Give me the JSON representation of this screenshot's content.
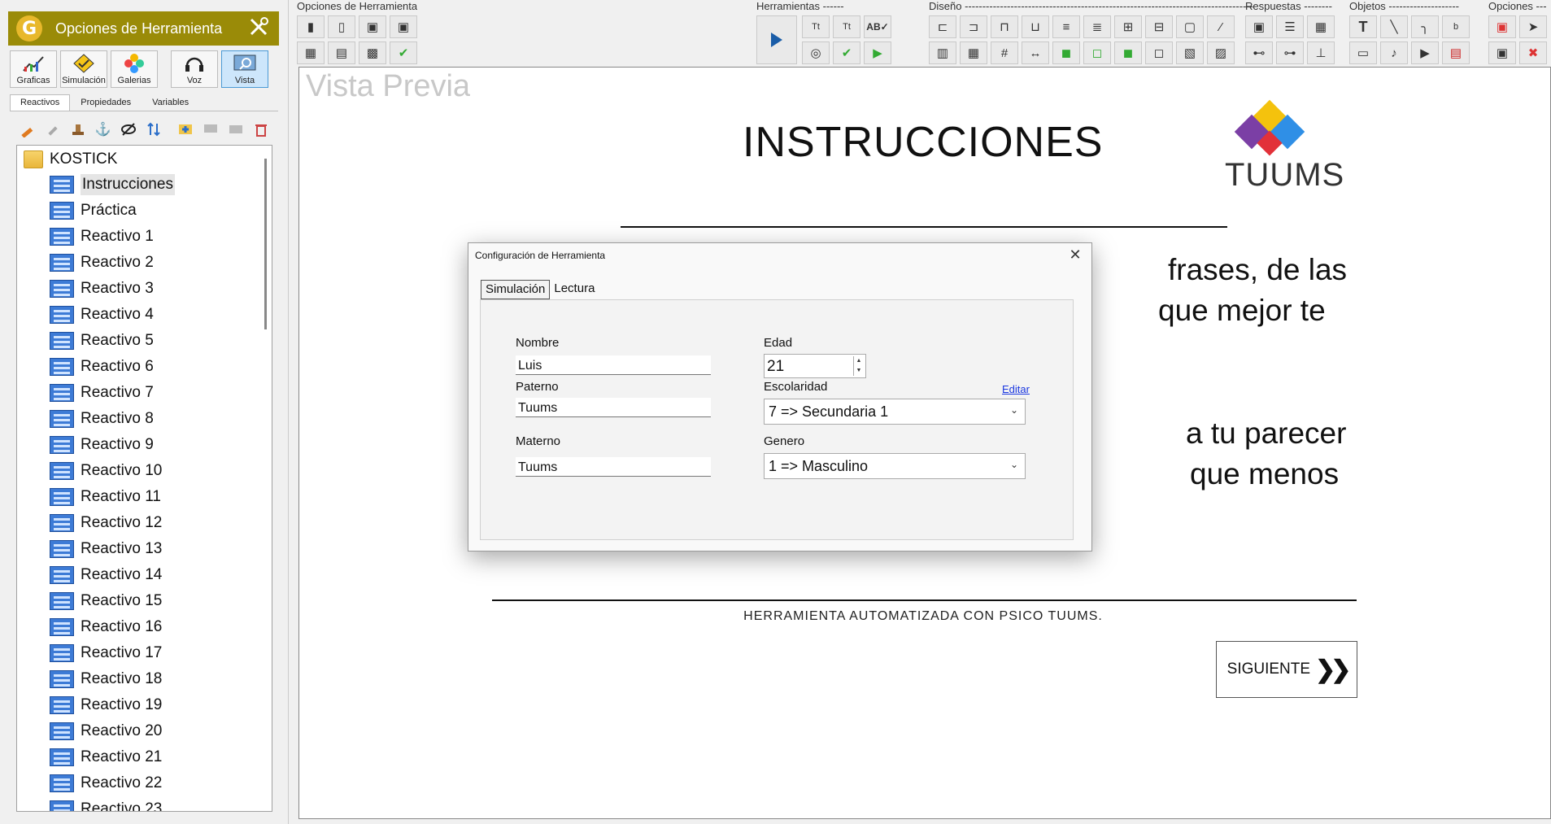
{
  "app": {
    "title": "Opciones de Herramienta",
    "brand_color": "#9a8b08"
  },
  "mode_buttons": [
    {
      "label": "Graficas",
      "icon": "chart-icon",
      "selected": false
    },
    {
      "label": "Simulación",
      "icon": "simulation-icon",
      "selected": false
    },
    {
      "label": "Galerias",
      "icon": "gallery-icon",
      "selected": false
    },
    {
      "label": "Voz",
      "icon": "headset-icon",
      "selected": false
    },
    {
      "label": "Vista",
      "icon": "preview-icon",
      "selected": true
    }
  ],
  "left_tabs": [
    "Reactivos",
    "Propiedades",
    "Variables"
  ],
  "tree": {
    "root": "KOSTICK",
    "items": [
      "Instrucciones",
      "Práctica",
      "Reactivo 1",
      "Reactivo 2",
      "Reactivo 3",
      "Reactivo 4",
      "Reactivo 5",
      "Reactivo 6",
      "Reactivo 7",
      "Reactivo 8",
      "Reactivo 9",
      "Reactivo 10",
      "Reactivo 11",
      "Reactivo 12",
      "Reactivo 13",
      "Reactivo 14",
      "Reactivo 15",
      "Reactivo 16",
      "Reactivo 17",
      "Reactivo 18",
      "Reactivo 19",
      "Reactivo 20",
      "Reactivo 21",
      "Reactivo 22",
      "Reactivo 23"
    ],
    "selected": "Instrucciones"
  },
  "toolbar": {
    "sections": {
      "opciones": "Opciones de Herramienta",
      "herramientas": "Herramientas ------",
      "diseno": "Diseño -----------------------------------------------------------------------------------",
      "respuestas": "Respuestas --------",
      "objetos": "Objetos --------------------",
      "opciones2": "Opciones ---"
    }
  },
  "preview": {
    "label": "Vista Previa",
    "heading": "INSTRUCCIONES",
    "logo_text": "TUUMS",
    "logo_colors": [
      "#7b3fa5",
      "#f4c20d",
      "#2f8fe6",
      "#e23139"
    ],
    "text_lines": [
      "frases, de las",
      "que   mejor   te",
      "a tu parecer",
      "que   menos"
    ],
    "footer": "HERRAMIENTA AUTOMATIZADA CON PSICO TUUMS.",
    "next_label": "SIGUIENTE",
    "next_icon": "double-chevron-right-icon"
  },
  "dialog": {
    "title": "Configuración de Herramienta",
    "tabs": [
      "Simulación",
      "Lectura"
    ],
    "fields": {
      "nombre_label": "Nombre",
      "nombre_value": "Luis",
      "paterno_label": "Paterno",
      "paterno_value": "Tuums",
      "materno_label": "Materno",
      "materno_value": "Tuums",
      "edad_label": "Edad",
      "edad_value": "21",
      "escolaridad_label": "Escolaridad",
      "escolaridad_value": "7 => Secundaria 1",
      "editar_link": "Editar",
      "genero_label": "Genero",
      "genero_value": "1 => Masculino"
    }
  }
}
